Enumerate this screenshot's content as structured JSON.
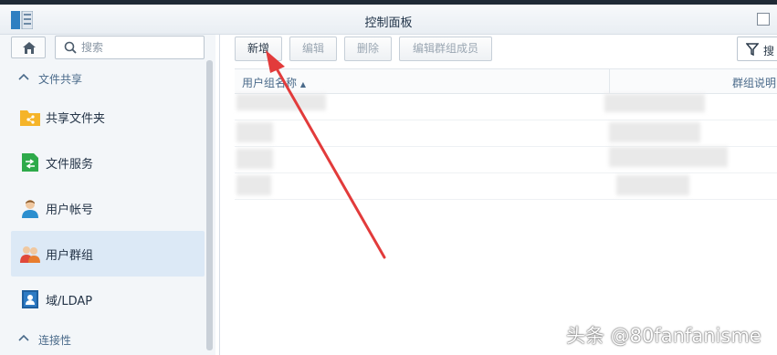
{
  "window": {
    "title": "控制面板"
  },
  "sidebar": {
    "search_placeholder": "搜索",
    "sections": [
      {
        "label": "文件共享",
        "expanded": true
      },
      {
        "label": "连接性",
        "expanded": true
      }
    ],
    "items": [
      {
        "label": "共享文件夹",
        "icon": "shared-folder-icon",
        "selected": false
      },
      {
        "label": "文件服务",
        "icon": "file-services-icon",
        "selected": false
      },
      {
        "label": "用户帐号",
        "icon": "user-account-icon",
        "selected": false
      },
      {
        "label": "用户群组",
        "icon": "user-group-icon",
        "selected": true
      },
      {
        "label": "域/LDAP",
        "icon": "domain-ldap-icon",
        "selected": false
      }
    ]
  },
  "toolbar": {
    "create_label": "新增",
    "edit_label": "编辑",
    "delete_label": "删除",
    "edit_members_label": "编辑群组成员",
    "search_label": "搜"
  },
  "table": {
    "columns": [
      "用户组名称",
      "群组说明"
    ],
    "sort_indicator": "▲"
  },
  "watermark": "头条 @80fanfanisme",
  "colors": {
    "selected_bg": "#dce9f6",
    "accent": "#4a6a8a",
    "annotation_arrow": "#e23b3b"
  }
}
